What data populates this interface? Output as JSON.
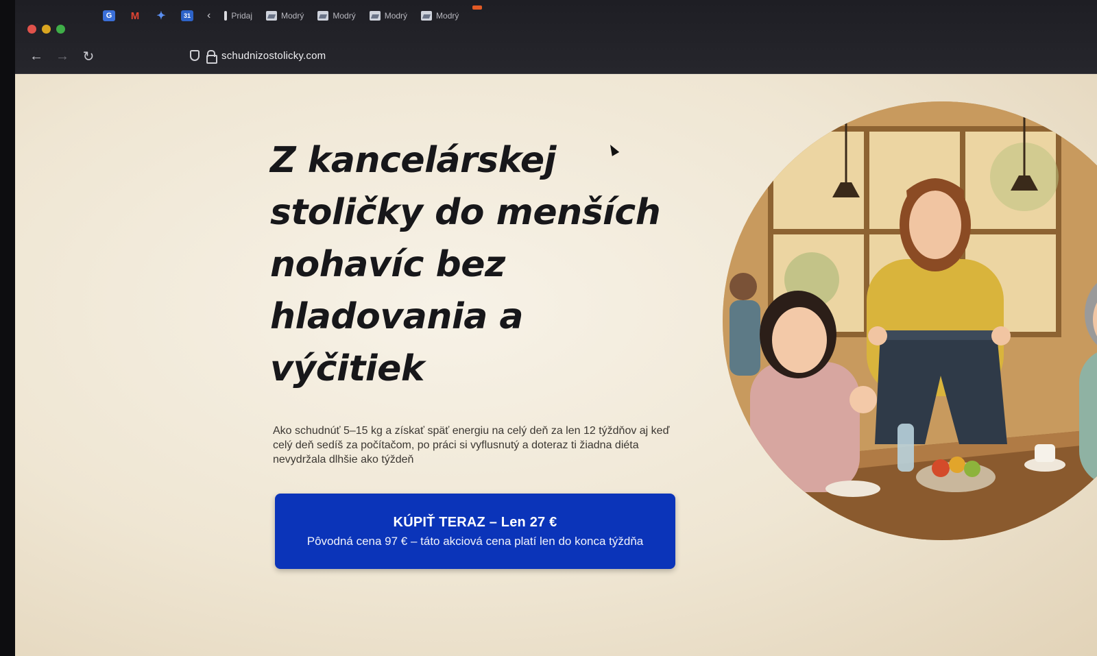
{
  "browser": {
    "pinned_tabs": [
      {
        "icon": "translate-icon",
        "glyph": "G"
      },
      {
        "icon": "gmail-icon",
        "glyph": "M"
      },
      {
        "icon": "gemini-star-icon",
        "glyph": "✦"
      },
      {
        "icon": "calendar-icon",
        "glyph": "31"
      }
    ],
    "tabs": [
      {
        "label": "Pridaj"
      },
      {
        "label": "Modrý"
      },
      {
        "label": "Modrý"
      },
      {
        "label": "Modrý"
      },
      {
        "label": "Modrý"
      }
    ],
    "url": "schudnizostolicky.com",
    "nav": {
      "back": "←",
      "forward": "→",
      "reload": "↻"
    }
  },
  "hero": {
    "headline": "Z kancelárskej stoličky do menších nohavíc bez hladovania a výčitiek",
    "subtext": "Ako schudnúť 5–15 kg a získať späť energiu na celý deň za len 12 týždňov aj keď celý deň sedíš za počítačom, po práci si vyflusnutý a doteraz ti žiadna diéta nevydržala dlhšie ako týždeň",
    "cta": {
      "title": "KÚPIŤ TERAZ – Len 27 €",
      "subtitle": "Pôvodná cena 97 € – táto akciová cena platí len do konca týždňa"
    }
  },
  "colors": {
    "cta_background": "#0b34b9",
    "headline": "#17171a",
    "page_background": "#f3ecdd"
  }
}
